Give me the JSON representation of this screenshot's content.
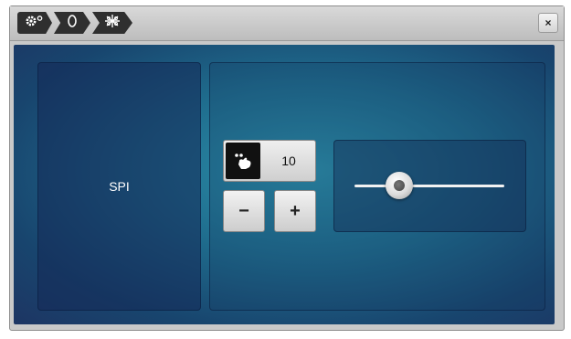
{
  "breadcrumb": {
    "items": [
      {
        "icon": "gear-settings-icon"
      },
      {
        "icon": "zero-mode-icon"
      },
      {
        "icon": "stitch-pattern-icon"
      }
    ]
  },
  "close_label": "×",
  "parameter": {
    "label": "SPI",
    "value": "10",
    "minus_label": "−",
    "plus_label": "+",
    "slider_level": 0.3
  },
  "colors": {
    "panel_bg_center": "#2d93ad",
    "panel_bg_edge": "#1d3563",
    "titlebar": "#c9c9c9",
    "crumb": "#2f2f2f"
  }
}
